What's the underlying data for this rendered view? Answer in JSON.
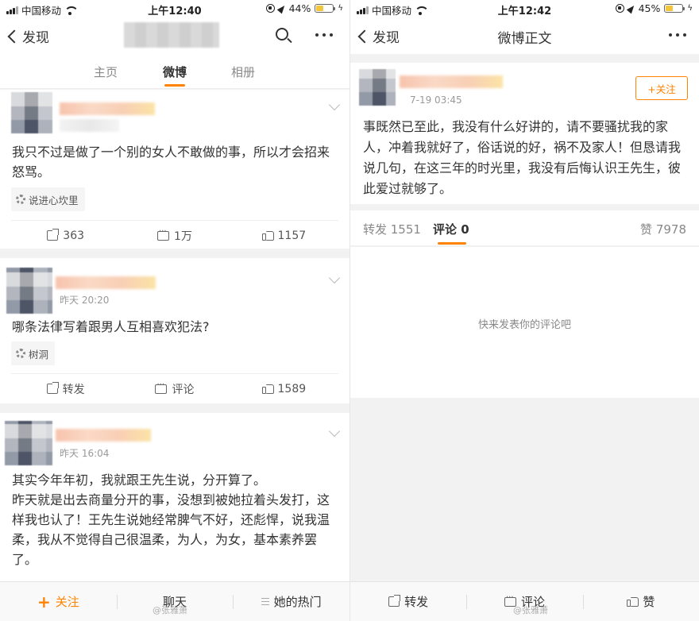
{
  "left": {
    "status": {
      "carrier": "中国移动",
      "time": "上午12:40",
      "battery": "44%",
      "battery_level": 0.44
    },
    "nav": {
      "back_label": "发现"
    },
    "tabs": [
      {
        "label": "主页"
      },
      {
        "label": "微博"
      },
      {
        "label": "相册"
      }
    ],
    "posts": [
      {
        "time": "",
        "text": "我只不过是做了一个别的女人不敢做的事，所以才会招来怒骂。",
        "topic": "说进心坎里",
        "repost": "363",
        "comment": "1万",
        "like": "1157"
      },
      {
        "time": "昨天 20:20",
        "text": "哪条法律写着跟男人互相喜欢犯法?",
        "topic": "树洞",
        "repost": "转发",
        "comment": "评论",
        "like": "1589"
      },
      {
        "time": "昨天 16:04",
        "text": "其实今年年初，我就跟王先生说，分开算了。\n昨天就是出去商量分开的事，没想到被她拉着头发打，这样我也认了！王先生说她经常脾气不好，还彪悍，说我温柔，我从不觉得自己很温柔，为人，为女，基本素养罢了。"
      }
    ],
    "bottom": {
      "follow": "关注",
      "chat": "聊天",
      "hot": "她的热门"
    },
    "watermark": "@张雅萧"
  },
  "right": {
    "status": {
      "carrier": "中国移动",
      "time": "上午12:42",
      "battery": "45%",
      "battery_level": 0.45
    },
    "nav": {
      "back_label": "发现",
      "title": "微博正文"
    },
    "post": {
      "time": "7-19 03:45",
      "follow_label": "+关注",
      "text": "事既然已至此，我没有什么好讲的，请不要骚扰我的家人，冲着我就好了，俗话说的好，祸不及家人！但恳请我说几句，在这三年的时光里，我没有后悔认识王先生，彼此爱过就够了。"
    },
    "comment_tabs": {
      "repost": "转发 1551",
      "comment": "评论 0",
      "like": "赞 7978"
    },
    "empty_text": "快来发表你的评论吧",
    "bottom": {
      "repost": "转发",
      "comment": "评论",
      "like": "赞"
    },
    "watermark": "@张雅萧"
  }
}
